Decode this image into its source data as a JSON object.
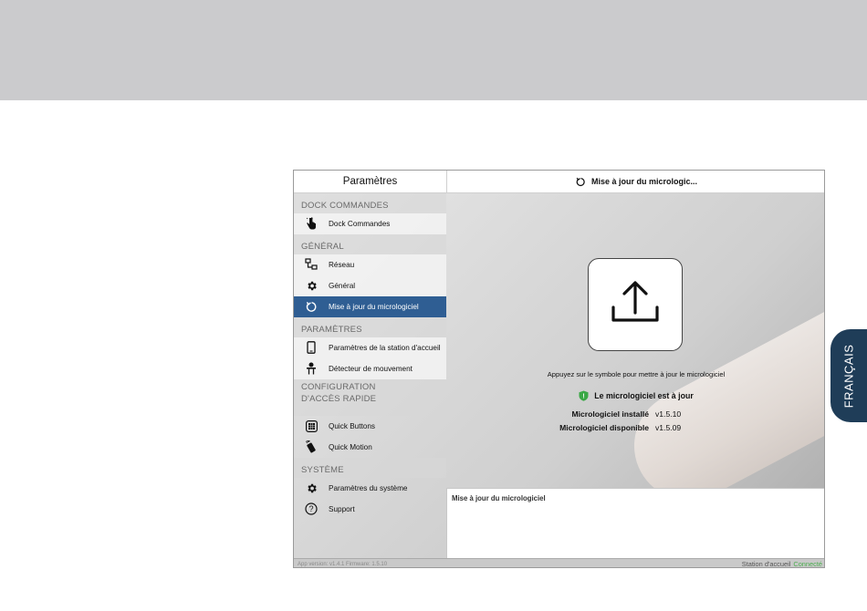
{
  "language_tab": {
    "label": "FRANÇAIS"
  },
  "sidebar": {
    "title": "Paramètres",
    "sections": [
      {
        "label": "DOCK COMMANDES",
        "items": [
          {
            "label": "Dock Commandes",
            "icon": "hand-tap-icon"
          }
        ]
      },
      {
        "label": "GÉNÉRAL",
        "items": [
          {
            "label": "Réseau",
            "icon": "network-icon"
          },
          {
            "label": "Général",
            "icon": "gear-icon"
          },
          {
            "label": "Mise à jour du micrologiciel",
            "icon": "refresh-icon",
            "selected": true
          }
        ]
      },
      {
        "label": "PARAMÈTRES",
        "items": [
          {
            "label": "Paramètres de la station d'accueil",
            "icon": "phone-icon"
          },
          {
            "label": "Détecteur de mouvement",
            "icon": "motion-sensor-icon"
          }
        ]
      },
      {
        "label_line1": "CONFIGURATION",
        "label_line2": "D'ACCÈS RAPIDE",
        "items": [
          {
            "label": "Quick Buttons",
            "icon": "keypad-icon"
          },
          {
            "label": "Quick Motion",
            "icon": "remote-icon"
          }
        ]
      },
      {
        "label": "SYSTÈME",
        "items": [
          {
            "label": "Paramètres du système",
            "icon": "gear-icon"
          },
          {
            "label": "Support",
            "icon": "question-circle-icon"
          }
        ]
      }
    ]
  },
  "detail": {
    "title": "Mise à jour du micrologic...",
    "instruction": "Appuyez sur le symbole pour mettre à jour le micrologiciel",
    "status": "Le micrologiciel est à jour",
    "installed_label": "Micrologiciel installé",
    "installed_value": "v1.5.10",
    "available_label": "Micrologiciel disponible",
    "available_value": "v1.5.09",
    "log_title": "Mise à jour du micrologiciel"
  },
  "statusbar": {
    "left": "App version: v1.4.1 Firmware: 1.5.10",
    "station_label": "Station d'accueil",
    "station_state": "Connecté"
  },
  "colors": {
    "accent": "#2f5e93",
    "language_tab": "#1f3d58",
    "connected": "#4caf50",
    "shield_ok": "#3aa845"
  }
}
